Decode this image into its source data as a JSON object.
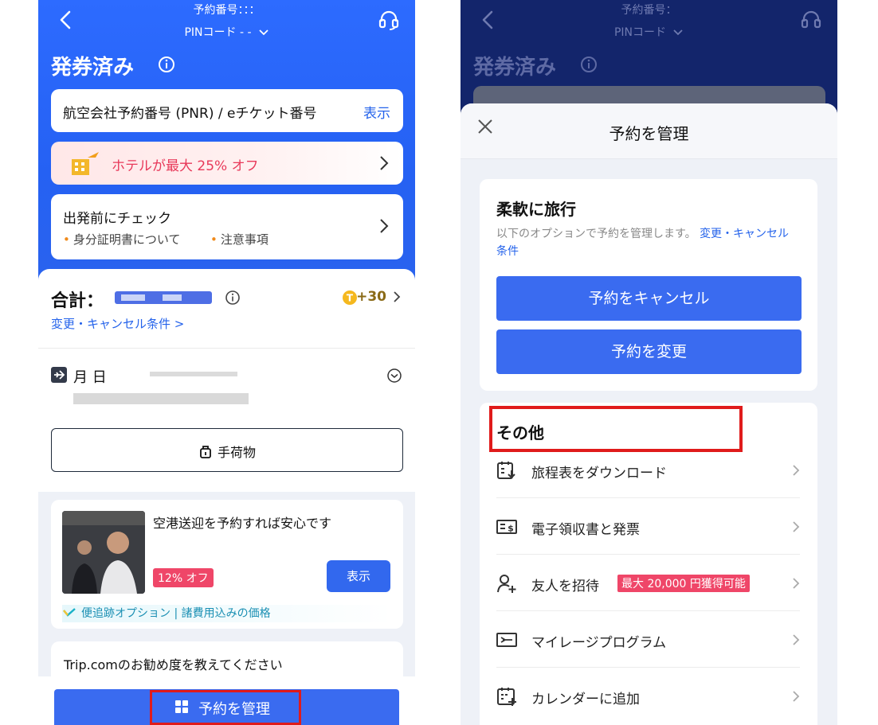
{
  "left": {
    "header": {
      "booking_no_label": "予約番号：：：",
      "pin_label": "PINコード - -",
      "status_title": "発券済み"
    },
    "pnr_card": {
      "label": "航空会社予約番号 (PNR) / eチケット番号",
      "action": "表示"
    },
    "hotel_promo": {
      "label": "ホテルが最大 25% オフ"
    },
    "precheck": {
      "title": "出発前にチェック",
      "items": [
        "身分証明書について",
        "注意事項"
      ]
    },
    "total": {
      "label": "合計：",
      "points": "+30",
      "cancel_link": "変更・キャンセル条件 >"
    },
    "flight": {
      "date": "月 日"
    },
    "baggage_button": "手荷物",
    "transfer_promo": {
      "title": "空港送迎を予約すれば安心です",
      "discount": "12% オフ",
      "show_button": "表示",
      "note": "便追跡オプション | 諸費用込みの価格"
    },
    "survey": {
      "title": "Trip.comのお勧め度を教えてください"
    },
    "manage_button": "予約を管理"
  },
  "right": {
    "header": {
      "booking_no_label": "予約番号：",
      "pin_label": "PINコード",
      "status_title": "発券済み"
    },
    "sheet_title": "予約を管理",
    "flexible": {
      "title": "柔軟に旅行",
      "desc": "以下のオプションで予約を管理します。",
      "desc_link": "変更・キャンセル条件",
      "cancel_button": "予約をキャンセル",
      "change_button": "予約を変更"
    },
    "other": {
      "title": "その他",
      "items": [
        {
          "label": "旅程表をダウンロード",
          "icon": "itinerary-download-icon"
        },
        {
          "label": "電子領収書と発票",
          "icon": "receipt-icon"
        },
        {
          "label": "友人を招待",
          "icon": "invite-friend-icon",
          "badge": "最大 20,000 円獲得可能"
        },
        {
          "label": "マイレージプログラム",
          "icon": "mileage-icon"
        },
        {
          "label": "カレンダーに追加",
          "icon": "calendar-add-icon"
        }
      ]
    }
  },
  "colors": {
    "brand_blue": "#2d6bff",
    "button_blue": "#3a6bf0",
    "link_blue": "#2563eb",
    "promo_pink": "#ef4668",
    "highlight_red": "#e01b1b"
  }
}
